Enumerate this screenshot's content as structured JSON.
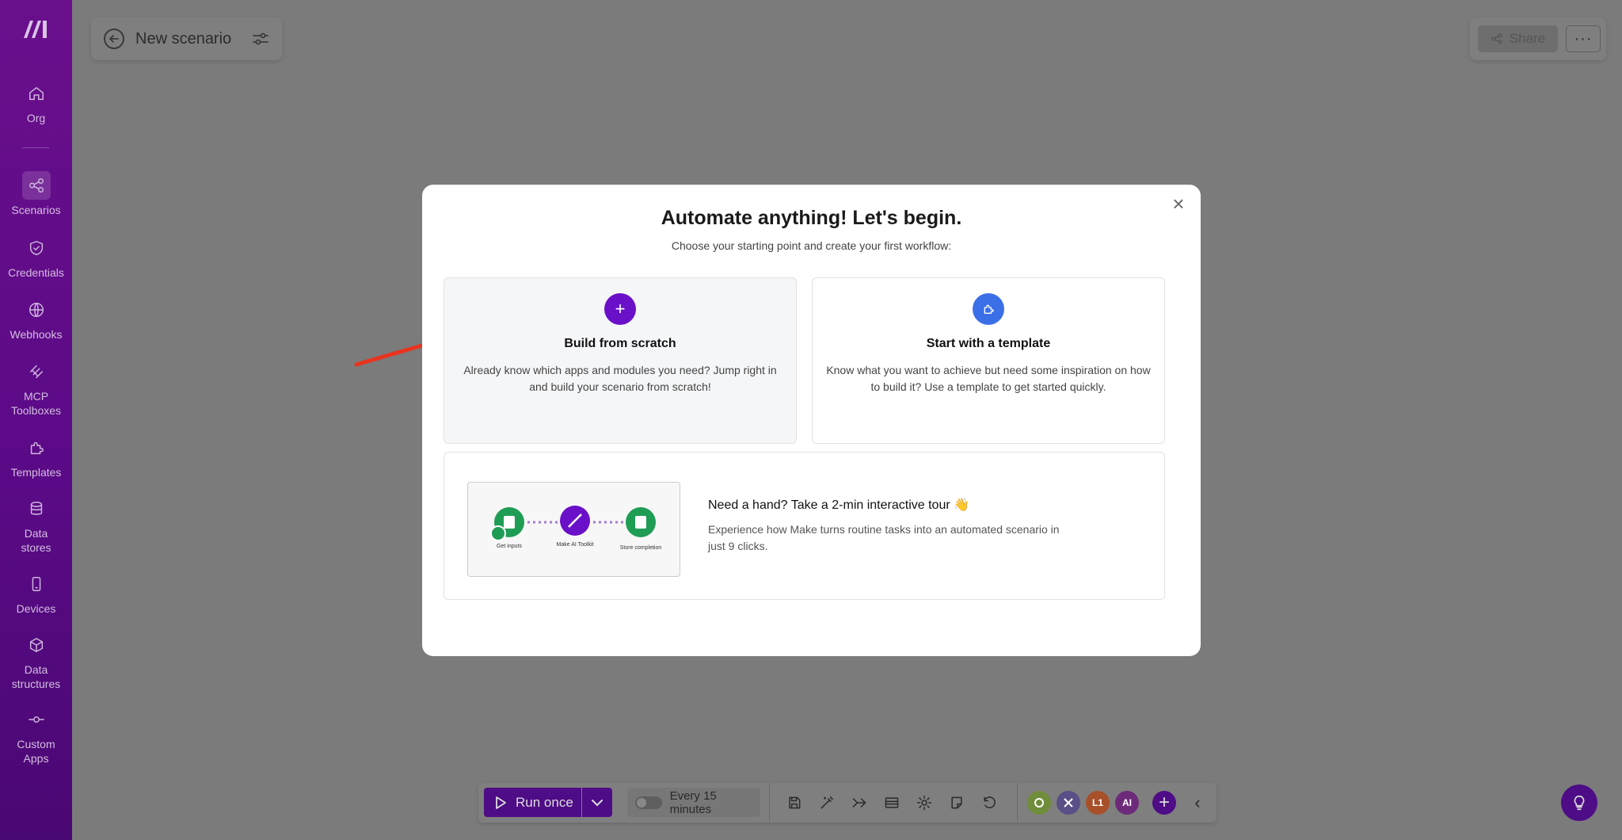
{
  "sidebar": {
    "items": [
      {
        "label": "Org",
        "icon": "home-icon"
      },
      {
        "label": "Scenarios",
        "icon": "share-nodes-icon",
        "active": true
      },
      {
        "label": "Credentials",
        "icon": "shield-icon"
      },
      {
        "label": "Webhooks",
        "icon": "globe-icon"
      },
      {
        "label": "MCP Toolboxes",
        "icon": "mcp-icon"
      },
      {
        "label": "Templates",
        "icon": "puzzle-icon"
      },
      {
        "label": "Data stores",
        "icon": "database-icon"
      },
      {
        "label": "Devices",
        "icon": "mobile-icon"
      },
      {
        "label": "Data structures",
        "icon": "cube-icon"
      },
      {
        "label": "Custom Apps",
        "icon": "commit-icon"
      }
    ]
  },
  "header": {
    "title": "New scenario",
    "share_label": "Share",
    "more_label": "···"
  },
  "modal": {
    "title": "Automate anything! Let's begin.",
    "subtitle": "Choose your starting point and create your first workflow:",
    "close_label": "×",
    "cards": [
      {
        "title": "Build from scratch",
        "description": "Already know which apps and modules you need? Jump right in and build your scenario from scratch!",
        "icon_label": "+"
      },
      {
        "title": "Start with a template",
        "description": "Know what you want to achieve but need some inspiration on how to build it? Use a template to get started quickly."
      }
    ],
    "tour": {
      "title": "Need a hand? Take a 2-min interactive tour 👋",
      "description": "Experience how Make turns routine tasks into an automated scenario in just 9 clicks.",
      "thumb_labels": [
        "Get inputs",
        "Make AI Toolkit",
        "Store completion"
      ]
    }
  },
  "toolbar": {
    "run_label": "Run once",
    "schedule_label": "Every 15 minutes",
    "app_badges": [
      {
        "label": "",
        "color": "#6f8d3a"
      },
      {
        "label": "",
        "color": "#5a4f86"
      },
      {
        "label": "L1",
        "color": "#a8502a"
      },
      {
        "label": "AI",
        "color": "#6d2a7a"
      }
    ],
    "add_label": "+"
  },
  "colors": {
    "sidebar": "#5b0a87",
    "accent_purple": "#6a10c9",
    "accent_blue": "#3b6fe8",
    "arrow": "#e8331e"
  }
}
